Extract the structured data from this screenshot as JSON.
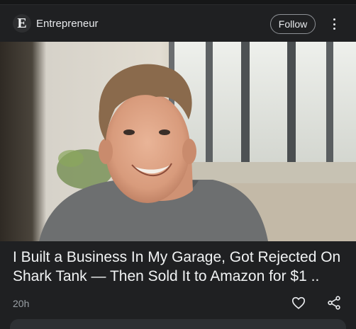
{
  "header": {
    "logo_letter": "E",
    "source_name": "Entrepreneur",
    "follow_label": "Follow",
    "more_icon": "more-vert-icon"
  },
  "article": {
    "image_icon": "article-photo",
    "headline": "I Built a Business In My Garage, Got Rejected On Shark Tank — Then Sold It to Amazon for $1 ..",
    "time": "20h",
    "like_icon": "heart-icon",
    "share_icon": "share-icon"
  },
  "colors": {
    "background": "#1f2022",
    "text": "#e8eaed",
    "muted": "#9aa0a6"
  }
}
